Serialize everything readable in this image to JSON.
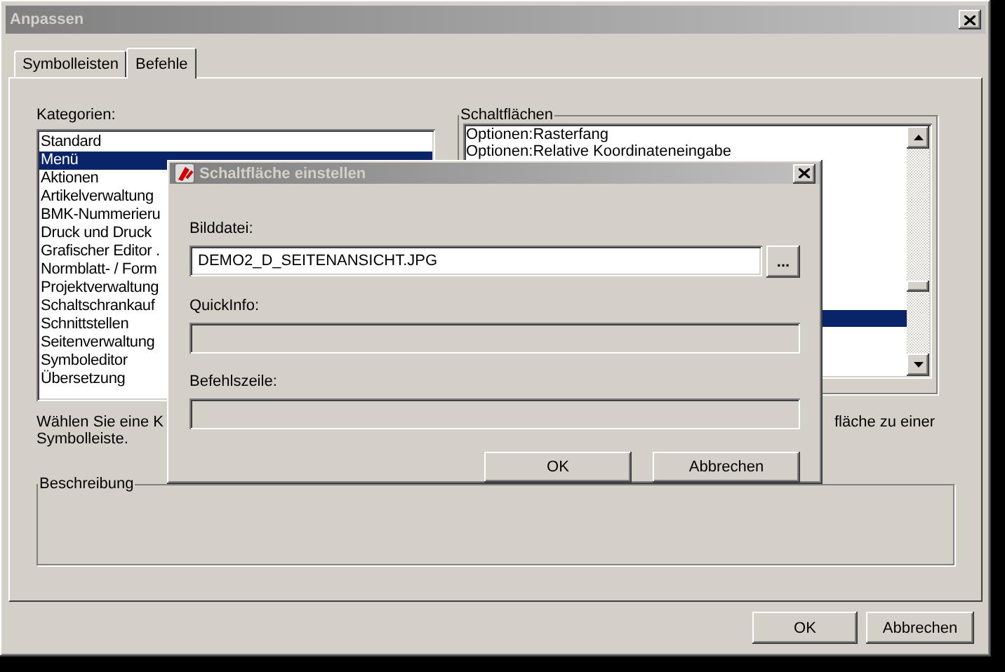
{
  "window": {
    "title": "Anpassen"
  },
  "tabs": [
    {
      "label": "Symbolleisten",
      "selected": false
    },
    {
      "label": "Befehle",
      "selected": true
    }
  ],
  "categories": {
    "label": "Kategorien:",
    "items": [
      {
        "label": "Standard",
        "selected": false
      },
      {
        "label": "Menü",
        "selected": true
      },
      {
        "label": "Aktionen",
        "selected": false
      },
      {
        "label": "Artikelverwaltung",
        "selected": false
      },
      {
        "label": "BMK-Nummerieru",
        "selected": false
      },
      {
        "label": "Druck und Druck",
        "selected": false
      },
      {
        "label": "Grafischer Editor .",
        "selected": false
      },
      {
        "label": "Normblatt- / Form",
        "selected": false
      },
      {
        "label": "Projektverwaltung",
        "selected": false
      },
      {
        "label": "Schaltschrankauf",
        "selected": false
      },
      {
        "label": "Schnittstellen",
        "selected": false
      },
      {
        "label": "Seitenverwaltung",
        "selected": false
      },
      {
        "label": "Symboleditor",
        "selected": false
      },
      {
        "label": "Übersetzung",
        "selected": false
      }
    ]
  },
  "commands": {
    "label": "Schaltflächen",
    "items": [
      {
        "label": "Optionen:Rasterfang",
        "selected": false
      },
      {
        "label": "Optionen:Relative Koordinateneingabe",
        "selected": false
      },
      {
        "selected": true
      }
    ]
  },
  "hint": {
    "left": "Wählen Sie eine K",
    "right": "fläche zu einer",
    "line2": "Symbolleiste."
  },
  "description": {
    "label": "Beschreibung"
  },
  "buttons": [
    "OK",
    "Abbrechen"
  ],
  "dialog": {
    "title": "Schaltfläche einstellen",
    "fields": [
      {
        "label": "Bilddatei:",
        "value": "DEMO2_D_SEITENANSICHT.JPG",
        "browse": "...",
        "disabled": false
      },
      {
        "label": "QuickInfo:",
        "disabled": true
      },
      {
        "label": "Befehlszeile:",
        "disabled": true
      }
    ],
    "buttons": [
      "OK",
      "Abbrechen"
    ]
  }
}
